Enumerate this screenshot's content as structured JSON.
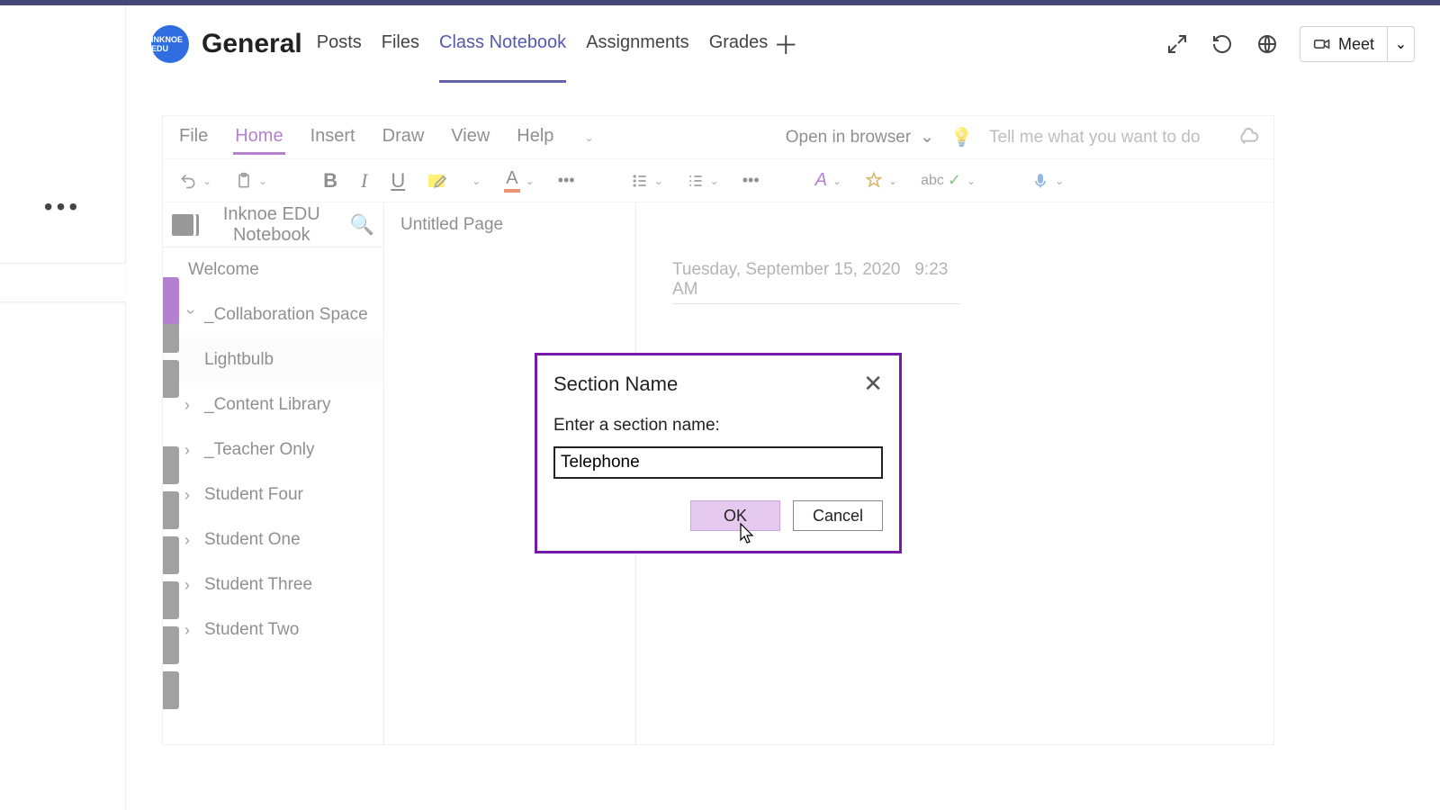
{
  "team_avatar_text": "INKNOE EDU",
  "channel_name": "General",
  "tabs": [
    "Posts",
    "Files",
    "Class Notebook",
    "Assignments",
    "Grades"
  ],
  "active_tab": "Class Notebook",
  "meet_label": "Meet",
  "onenote": {
    "menu": [
      "File",
      "Home",
      "Insert",
      "Draw",
      "View",
      "Help"
    ],
    "active_menu": "Home",
    "open_in_browser": "Open in browser",
    "tell_me_placeholder": "Tell me what you want to do",
    "notebook_title": "Inknoe EDU Notebook",
    "sections": [
      {
        "label": "Welcome",
        "kind": "item"
      },
      {
        "label": "_Collaboration Space",
        "kind": "group",
        "expanded": true
      },
      {
        "label": "Lightbulb",
        "kind": "page"
      },
      {
        "label": "_Content Library",
        "kind": "group"
      },
      {
        "label": "_Teacher Only",
        "kind": "group"
      },
      {
        "label": "Student Four",
        "kind": "group"
      },
      {
        "label": "Student One",
        "kind": "group"
      },
      {
        "label": "Student Three",
        "kind": "group"
      },
      {
        "label": "Student Two",
        "kind": "group"
      }
    ],
    "pages": [
      "Untitled Page"
    ],
    "page_date": "Tuesday, September 15, 2020",
    "page_time": "9:23 AM"
  },
  "toolbar_letters": {
    "bold": "B",
    "italic": "I",
    "underline": "U",
    "font_color": "A",
    "highlight": "A",
    "checkA": "A",
    "spell": "abc"
  },
  "dialog": {
    "title": "Section Name",
    "prompt": "Enter a section name:",
    "value": "Telephone",
    "ok": "OK",
    "cancel": "Cancel"
  }
}
